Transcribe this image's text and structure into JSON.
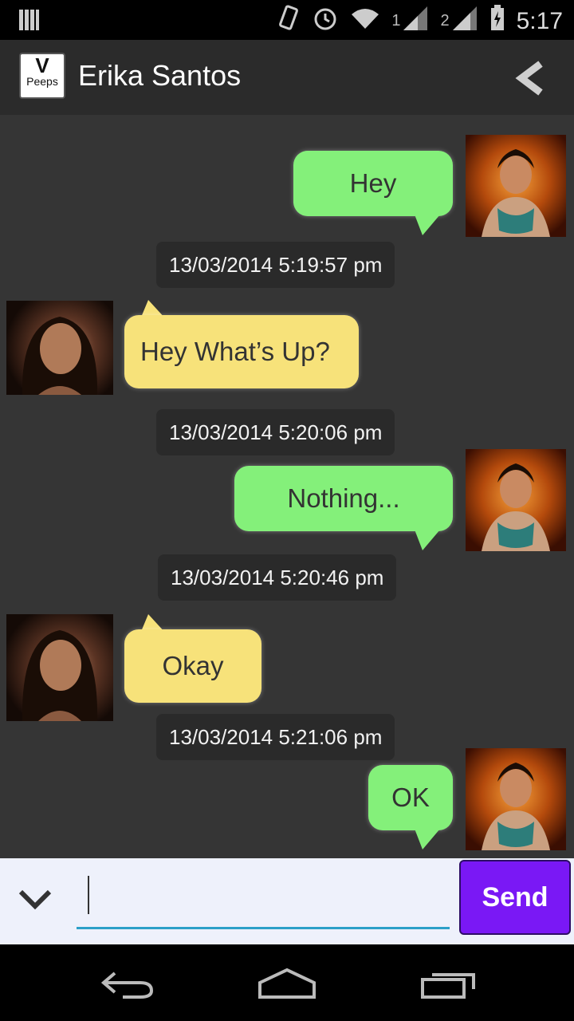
{
  "status_bar": {
    "sim1": "1",
    "sim2": "2",
    "time": "5:17"
  },
  "header": {
    "logo_top": "V",
    "logo_bottom": "Peeps",
    "contact_name": "Erika Santos"
  },
  "messages": [
    {
      "sender": "me",
      "text": "Hey",
      "timestamp": "13/03/2014 5:19:57 pm"
    },
    {
      "sender": "them",
      "text": "Hey What’s Up?",
      "timestamp": "13/03/2014 5:20:06 pm"
    },
    {
      "sender": "me",
      "text": "Nothing...",
      "timestamp": "13/03/2014 5:20:46 pm"
    },
    {
      "sender": "them",
      "text": "Okay",
      "timestamp": "13/03/2014 5:21:06 pm"
    },
    {
      "sender": "me",
      "text": "OK",
      "timestamp": ""
    }
  ],
  "composer": {
    "input_value": "",
    "send_label": "Send"
  },
  "colors": {
    "my_bubble": "#84f07a",
    "their_bubble": "#f7e27a",
    "send_button": "#7a18f5",
    "chat_background": "#353535"
  }
}
